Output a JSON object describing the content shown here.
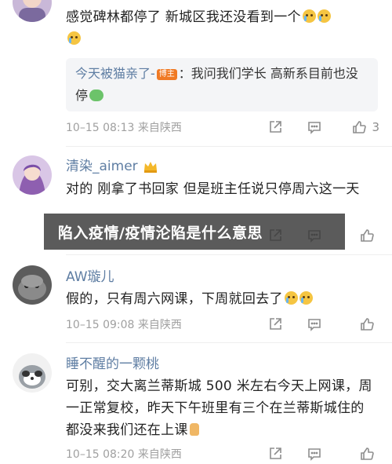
{
  "comments": [
    {
      "username": "",
      "text": "感觉碑林都停了  新城区我还没看到一个",
      "reply": {
        "name": "今天被猫亲了-",
        "badge": "博主",
        "text": "：我问我们学长 高新系目前也没停"
      },
      "time": "10–15 08:13",
      "location": "来自陕西",
      "likes": "3"
    },
    {
      "username": "清染_aimer",
      "text": "对的 刚拿了书回家 但是班主任说只停周六这一天",
      "time": "",
      "location": "",
      "likes": ""
    },
    {
      "username": "AW璇儿",
      "text": "假的，只有周六网课，下周就回去了",
      "time": "10–15 09:08",
      "location": "来自陕西",
      "likes": ""
    },
    {
      "username": "睡不醒的一颗桃",
      "text": "可别，交大离兰蒂斯城 500 米左右今天上网课，周一正常复校，昨天下午班里有三个在兰蒂斯城住的都没来我们还在上课",
      "time": "10–15 08:20",
      "location": "来自陕西",
      "likes": ""
    }
  ],
  "overlay_banner": "陷入疫情/疫情沦陷是什么意思",
  "icons": {
    "share": "share-icon",
    "reply": "comment-icon",
    "like": "thumbs-up-icon",
    "vip": "crown-badge-icon"
  },
  "colors": {
    "username": "#5f7ea3",
    "meta": "#a0a0a0",
    "badge": "#f07a24"
  }
}
